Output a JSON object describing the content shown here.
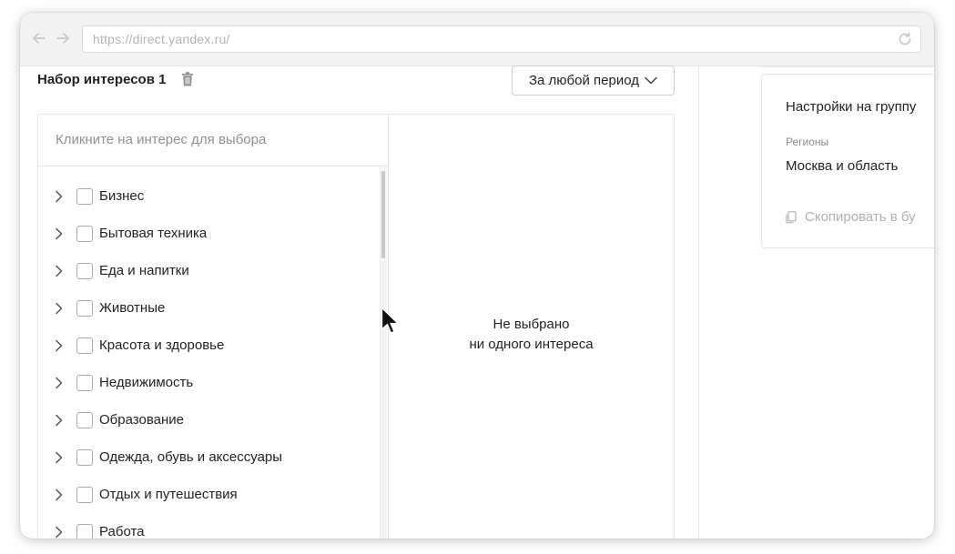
{
  "browser": {
    "url": "https://direct.yandex.ru/"
  },
  "interest_set": {
    "title": "Набор интересов 1",
    "period_label": "За любой период",
    "search_placeholder": "Кликните на интерес для выбора",
    "empty_line1": "Не выбрано",
    "empty_line2": "ни одного интереса",
    "categories": [
      "Бизнес",
      "Бытовая техника",
      "Еда и напитки",
      "Животные",
      "Красота и здоровье",
      "Недвижимость",
      "Образование",
      "Одежда, обувь и аксессуары",
      "Отдых и путешествия",
      "Работа"
    ]
  },
  "group_settings": {
    "title": "Настройки на группу",
    "regions_label": "Регионы",
    "regions_value": "Москва и область",
    "copy_label": "Скопировать в бу"
  },
  "icons": {
    "back": "arrow-left-icon",
    "forward": "arrow-right-icon",
    "reload": "reload-icon",
    "trash": "trash-icon",
    "dropdown": "chevron-down-icon",
    "expand": "chevron-right-icon",
    "copy": "copy-icon",
    "cursor": "mouse-pointer-icon"
  }
}
